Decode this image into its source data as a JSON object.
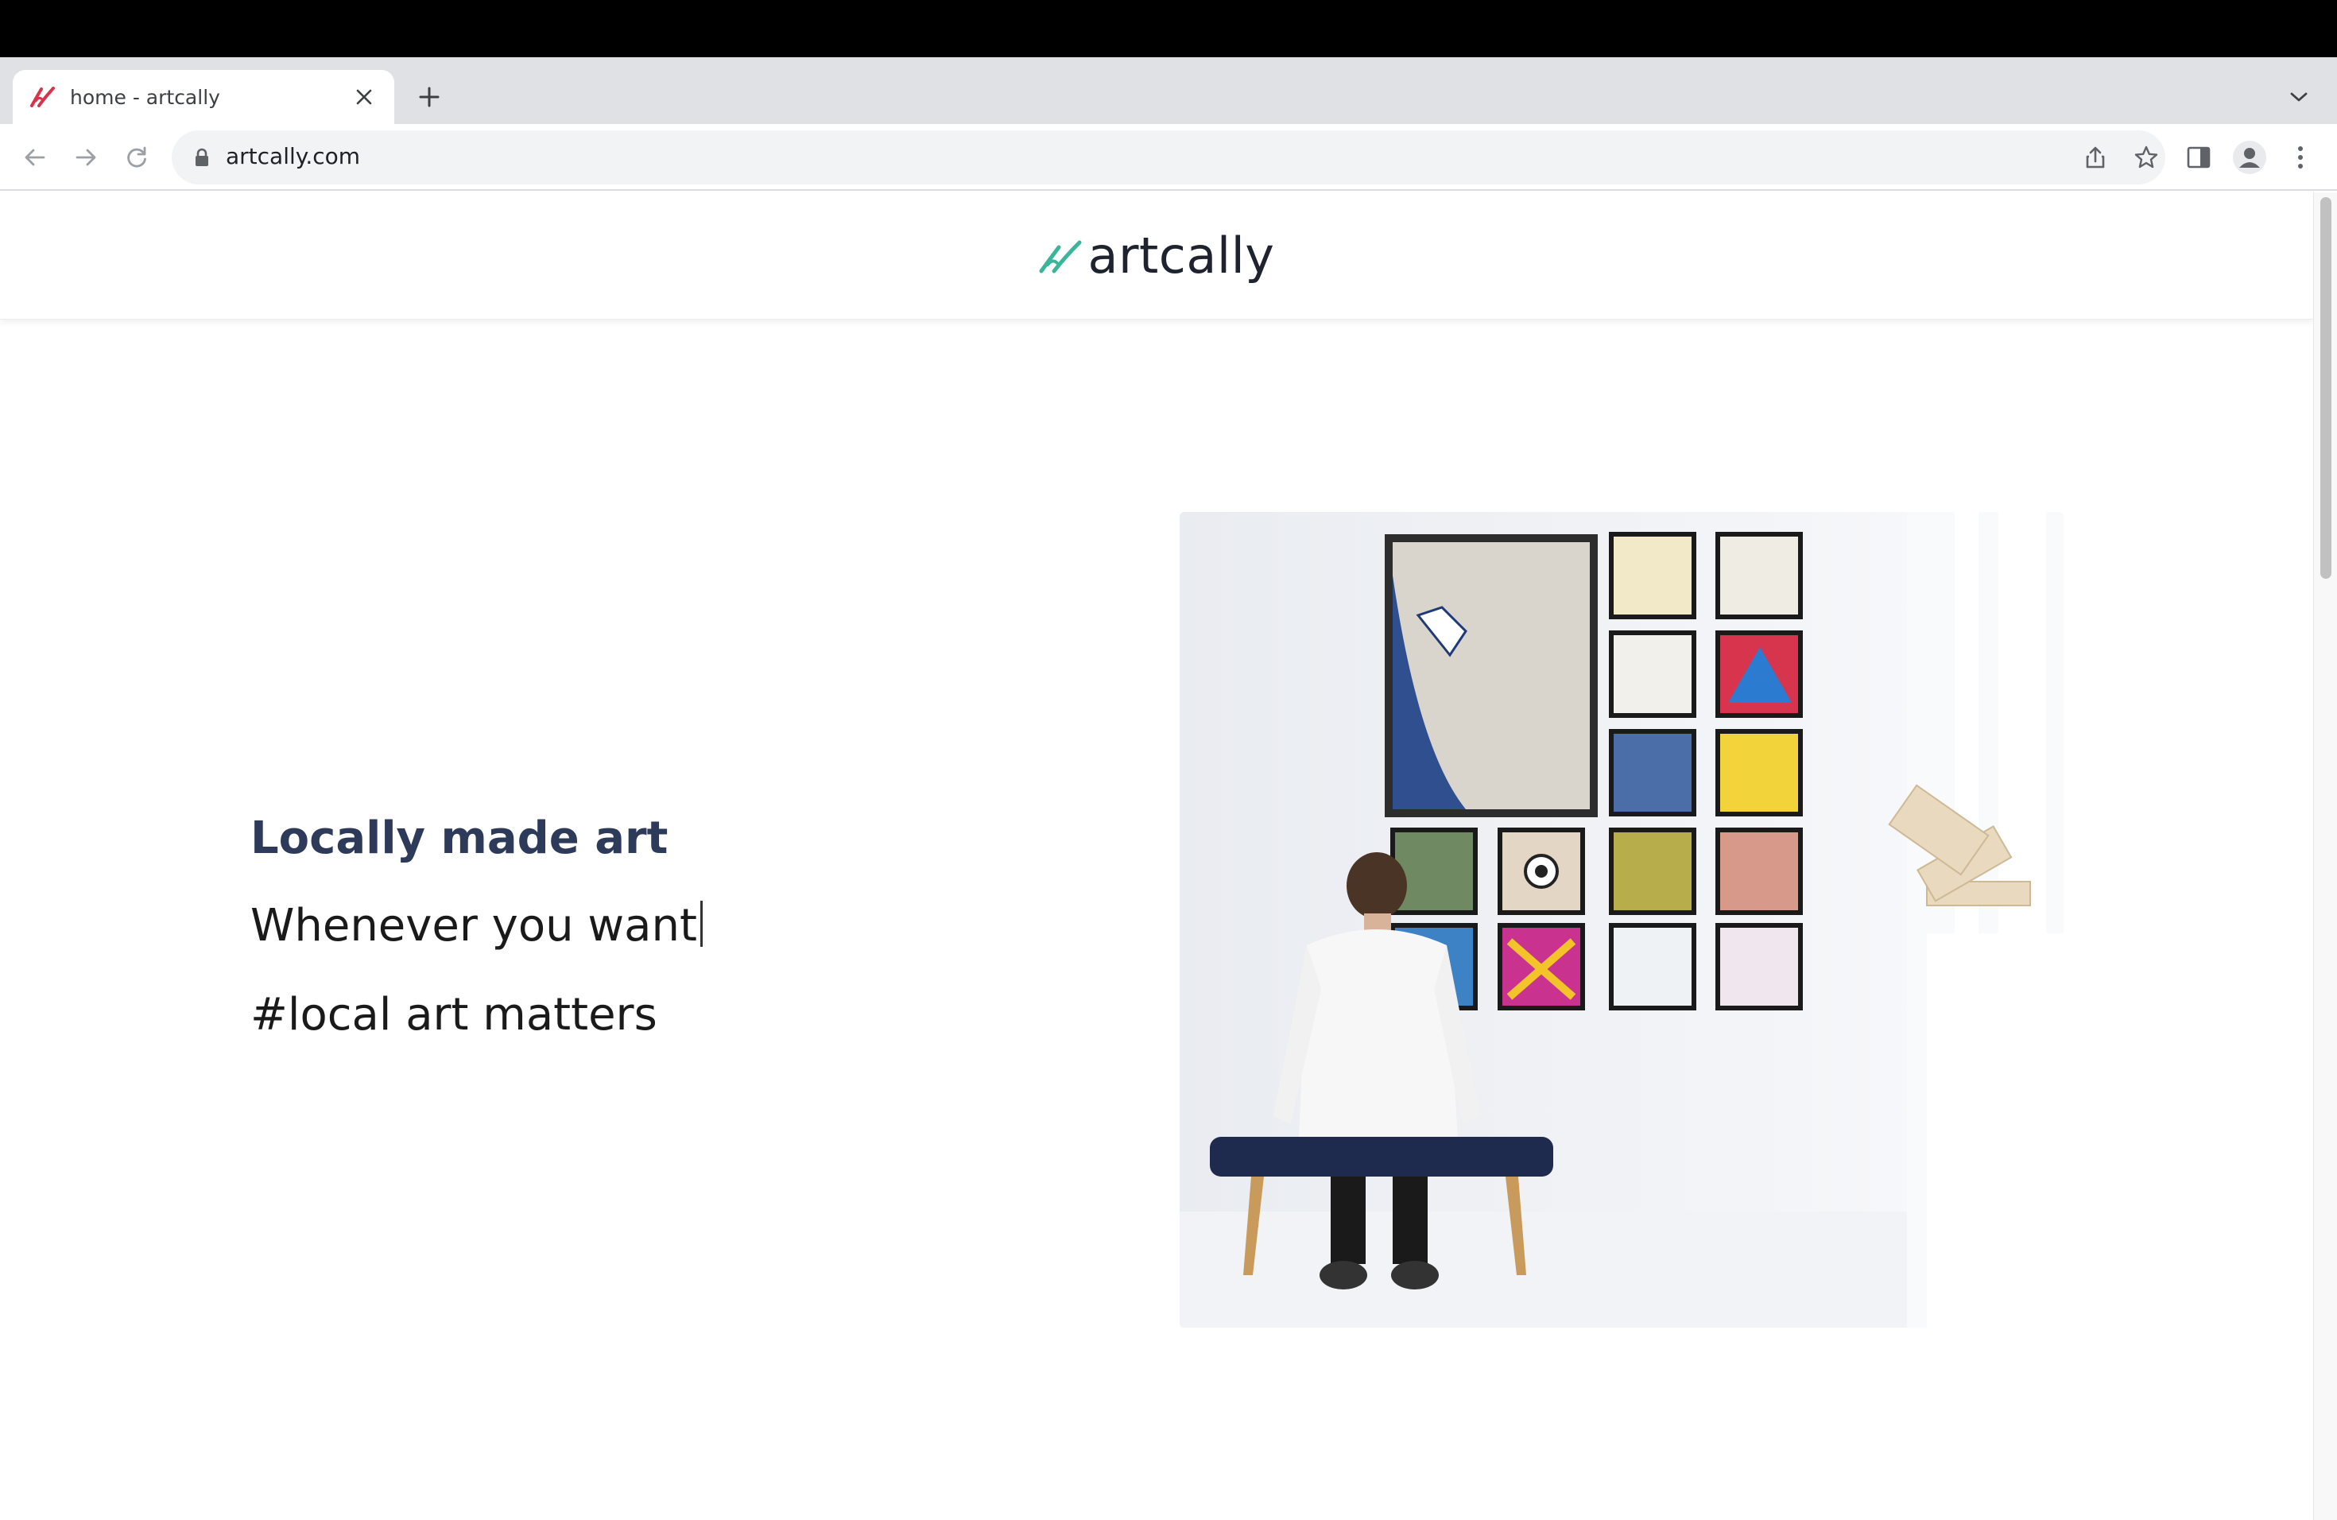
{
  "browser": {
    "tab": {
      "title": "home - artcally"
    },
    "address": {
      "url": "artcally.com"
    },
    "icons": {
      "favicon": "artcally-favicon-icon",
      "close": "close-icon",
      "new_tab": "plus-icon",
      "tab_list": "chevron-down-icon",
      "back": "back-arrow-icon",
      "forward": "forward-arrow-icon",
      "reload": "reload-icon",
      "lock": "lock-icon",
      "share": "share-icon",
      "bookmark": "star-icon",
      "side_panel": "side-panel-icon",
      "profile": "profile-icon",
      "menu": "kebab-menu-icon"
    }
  },
  "site": {
    "logo": {
      "text": "artcally"
    },
    "hero": {
      "title": "Locally made art",
      "subtitle": "Whenever you want",
      "tagline": "#local art matters"
    }
  },
  "colors": {
    "brand_green": "#3bb59a",
    "favicon_red": "#d6344a",
    "hero_title": "#2e3a59"
  }
}
